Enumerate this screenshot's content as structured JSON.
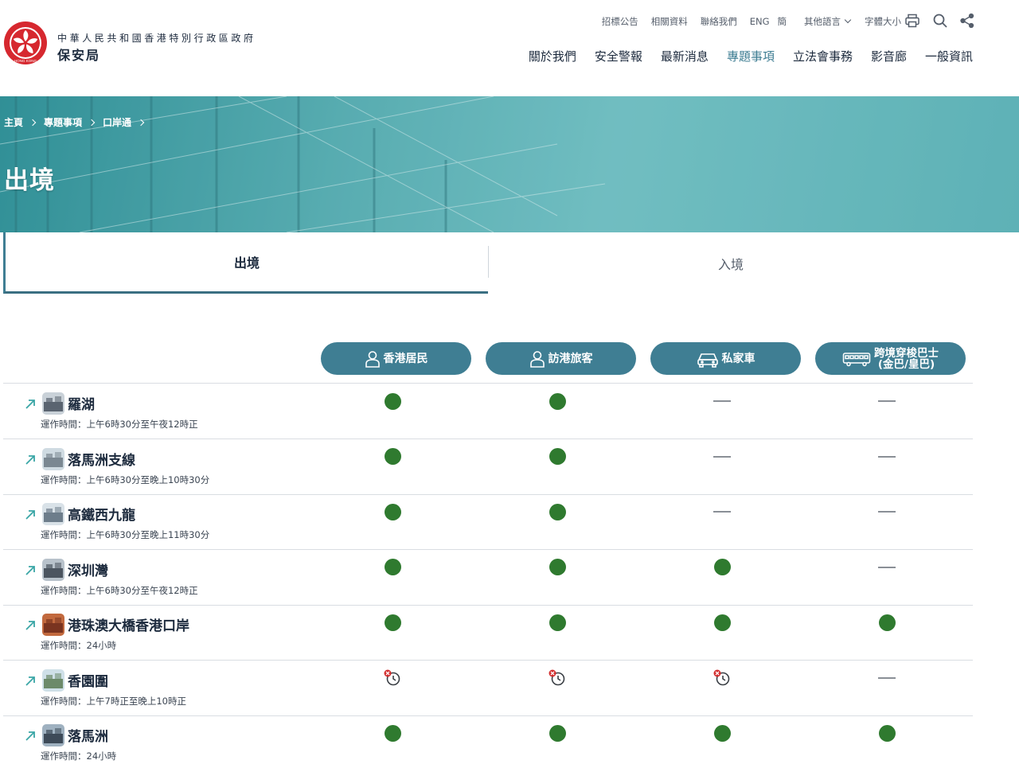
{
  "header": {
    "gov_name": "中華人民共和國香港特別行政區政府",
    "bureau_name": "保安局",
    "logo_text": "HONG KONG",
    "top_links": {
      "tenders": "招標公告",
      "resources": "相關資料",
      "contact": "聯絡我們",
      "english": "ENG",
      "simplified": "簡",
      "other_languages": "其他語言",
      "font_size": "字體大小"
    },
    "main_nav": {
      "about": "關於我們",
      "alerts": "安全警報",
      "news": "最新消息",
      "topics": "專題事項",
      "legco": "立法會事務",
      "gallery": "影音廊",
      "general": "一般資訊"
    },
    "colors": {
      "accent": "#3f7e93",
      "text": "#1c2a3d",
      "available": "#2f7a2f",
      "logo_red": "#d6282f"
    }
  },
  "breadcrumb": {
    "home": "主頁",
    "topics": "專題事項",
    "ports": "口岸通"
  },
  "page": {
    "title": "出境"
  },
  "tabs": {
    "departure": "出境",
    "arrival": "入境"
  },
  "columns": {
    "residents": "香港居民",
    "visitors": "訪港旅客",
    "private_car": "私家車",
    "bus_line1": "跨境穿梭巴士",
    "bus_line2": "(金巴/皇巴)"
  },
  "ports": [
    {
      "name": "羅湖",
      "hours": "運作時間：上午6時30分至午夜12時正",
      "status": [
        "available",
        "available",
        "none",
        "none"
      ]
    },
    {
      "name": "落馬洲支線",
      "hours": "運作時間：上午6時30分至晚上10時30分",
      "status": [
        "available",
        "available",
        "none",
        "none"
      ]
    },
    {
      "name": "高鐵西九龍",
      "hours": "運作時間：上午6時30分至晚上11時30分",
      "status": [
        "available",
        "available",
        "none",
        "none"
      ]
    },
    {
      "name": "深圳灣",
      "hours": "運作時間：上午6時30分至午夜12時正",
      "status": [
        "available",
        "available",
        "available",
        "none"
      ]
    },
    {
      "name": "港珠澳大橋香港口岸",
      "hours": "運作時間：24小時",
      "status": [
        "available",
        "available",
        "available",
        "available"
      ]
    },
    {
      "name": "香園圍",
      "hours": "運作時間：上午7時正至晚上10時正",
      "status": [
        "suspended",
        "suspended",
        "suspended",
        "none"
      ]
    },
    {
      "name": "落馬洲",
      "hours": "運作時間：24小時",
      "status": [
        "available",
        "available",
        "available",
        "available"
      ]
    }
  ]
}
